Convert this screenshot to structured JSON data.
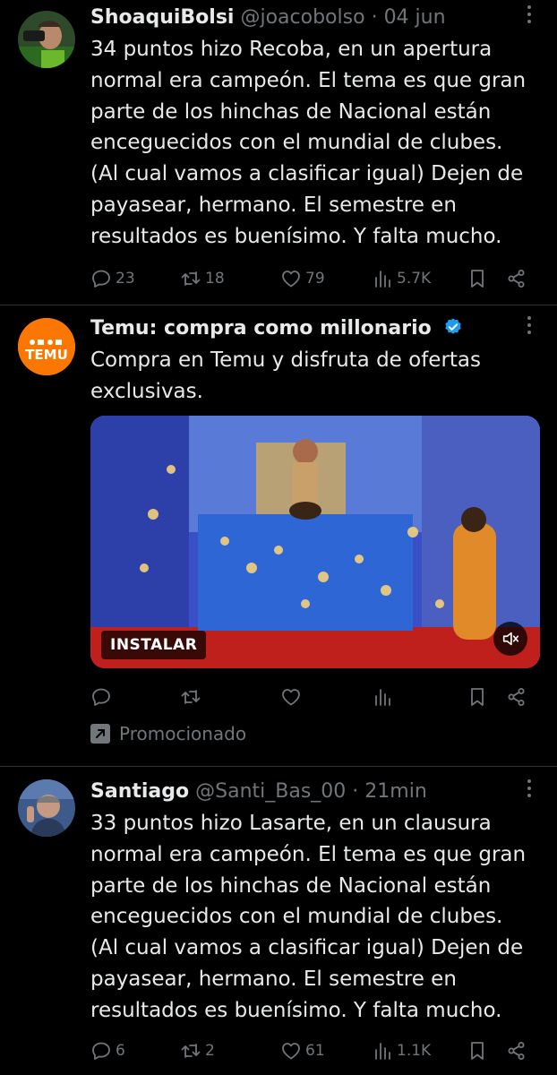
{
  "colors": {
    "background": "#000000",
    "text": "#e7e9ea",
    "muted": "#71767b",
    "divider": "#2f3336",
    "verified_blue": "#1d9bf0",
    "temu_orange": "#fb7701"
  },
  "tweets": [
    {
      "name": "ShoaquiBolsi",
      "handle": "@joacobolso",
      "dot": "·",
      "time": "04 jun",
      "text": "34 puntos hizo Recoba, en un apertura\nnormal era campeón. El tema es que gran\nparte de los hinchas de Nacional están\nenceguecidos con el mundial de clubes.\n(Al cual vamos a clasificar igual) Dejen de\npayasear, hermano. El semestre en\nresultados es buenísimo. Y falta mucho.",
      "replies": "23",
      "retweets": "18",
      "likes": "79",
      "views": "5.7K"
    },
    {
      "name": "Temu: compra como millonario",
      "text": "Compra en Temu y disfruta de ofertas\nexclusivas.",
      "avatar_text": "TEMU",
      "install_label": "INSTALAR",
      "promo_label": "Promocionado",
      "replies": "",
      "retweets": "",
      "likes": "",
      "views": ""
    },
    {
      "name": "Santiago",
      "handle": "@Santi_Bas_00",
      "dot": "·",
      "time": "21min",
      "text": "33 puntos hizo Lasarte, en un clausura\nnormal era campeón. El tema es que gran\nparte de los hinchas de Nacional están\nenceguecidos con el mundial de clubes.\n(Al cual vamos a clasificar igual) Dejen de\npayasear, hermano. El semestre en\nresultados es buenísimo. Y falta mucho.",
      "replies": "6",
      "retweets": "2",
      "likes": "61",
      "views": "1.1K"
    }
  ],
  "icons": {
    "reply": "reply-icon",
    "retweet": "retweet-icon",
    "like": "heart-icon",
    "views": "views-icon",
    "bookmark": "bookmark-icon",
    "share": "share-icon",
    "more": "more-icon",
    "mute": "mute-icon",
    "verified": "verified-icon",
    "promoted": "promoted-icon"
  }
}
